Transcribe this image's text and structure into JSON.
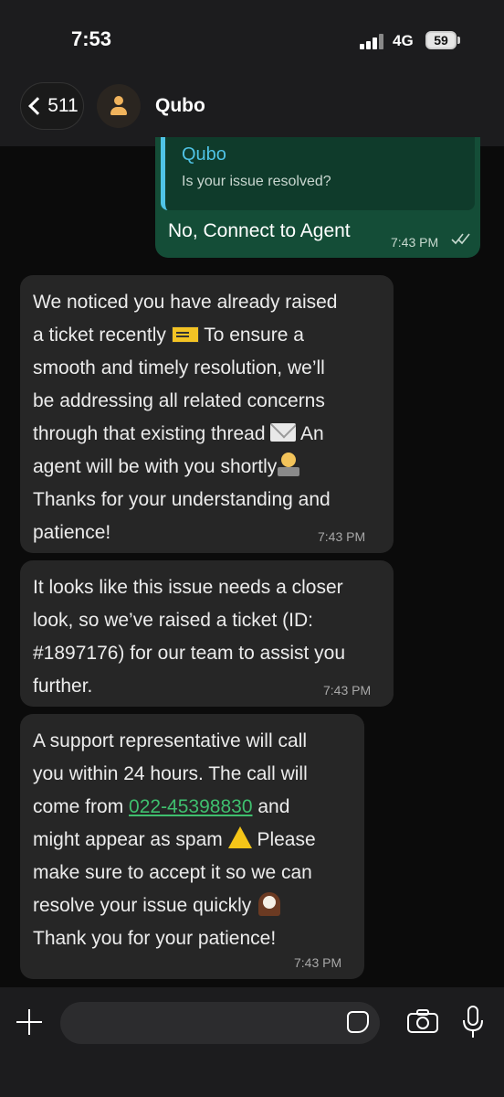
{
  "status_bar": {
    "time": "7:53",
    "network": "4G",
    "battery": "59"
  },
  "header": {
    "back_count": "511",
    "contact_name": "Qubo"
  },
  "messages": {
    "outgoing": {
      "quote_author": "Qubo",
      "quote_text": "Is your issue resolved?",
      "text": "No, Connect to Agent",
      "time": "7:43 PM"
    },
    "incoming": [
      {
        "line1": "We noticed you have already raised\na ticket recently ",
        "line2": " To ensure a\nsmooth and timely resolution, we’ll\nbe addressing all related concerns\nthrough that existing thread ",
        "line3": " An\nagent will be with you shortly",
        "line4": "\nThanks for your understanding and\npatience!",
        "time": "7:43 PM"
      },
      {
        "text": "It looks like this issue needs a closer\nlook, so we’ve raised a ticket (ID:\n#1897176) for our team to assist you\nfurther.",
        "time": "7:43 PM"
      },
      {
        "part1": "A support representative will call\nyou within 24 hours. The call will\ncome from ",
        "phone": "022-45398830",
        "part2": " and\nmight appear as spam ",
        "part3": " Please\nmake sure to accept it so we can\nresolve your issue quickly  ",
        "part4": "\nThank you for your patience!",
        "time": "7:43 PM"
      }
    ]
  },
  "icons": [
    "back-chevron-icon",
    "contact-avatar-icon",
    "ticket-emoji-icon",
    "envelope-emoji-icon",
    "technologist-emoji-icon",
    "warning-emoji-icon",
    "mantelpiece-clock-emoji-icon",
    "plus-icon",
    "sticker-icon",
    "camera-icon",
    "microphone-icon",
    "double-check-icon"
  ],
  "colors": {
    "outgoing_bubble": "#144d37",
    "incoming_bubble": "#262626",
    "quote_accent": "#4fc3e6",
    "link": "#3fbf6e"
  }
}
